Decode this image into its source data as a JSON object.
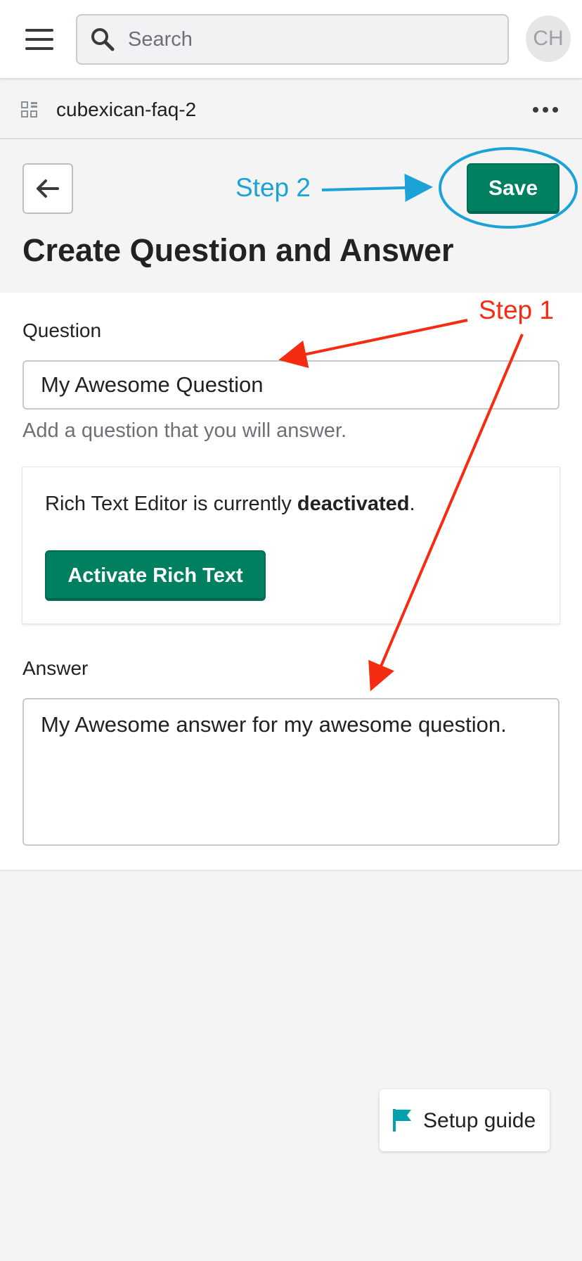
{
  "topbar": {
    "search_placeholder": "Search",
    "avatar_initials": "CH",
    "icons": [
      "hamburger-menu-icon",
      "search-icon"
    ]
  },
  "appbar": {
    "app_name": "cubexican-faq-2",
    "icons": [
      "apps-icon",
      "more-horizontal-icon"
    ]
  },
  "header": {
    "back_icon": "arrow-left-icon",
    "save_label": "Save",
    "title": "Create Question and Answer"
  },
  "form": {
    "question_label": "Question",
    "question_value": "My Awesome Question",
    "question_help": "Add a question that you will answer.",
    "rte_status_prefix": "Rich Text Editor is currently ",
    "rte_status_bold": "deactivated",
    "rte_status_suffix": ".",
    "activate_label": "Activate Rich Text",
    "answer_label": "Answer",
    "answer_value": "My Awesome answer for my awesome question."
  },
  "setup_guide": {
    "label": "Setup guide",
    "icon": "flag-icon"
  },
  "annotations": {
    "step1": "Step 1",
    "step2": "Step 2",
    "step1_color": "#f52c12",
    "step2_color": "#1ba3d8"
  },
  "colors": {
    "primary_button": "#008060",
    "background": "#f4f4f4",
    "flag": "#00a0ac"
  }
}
